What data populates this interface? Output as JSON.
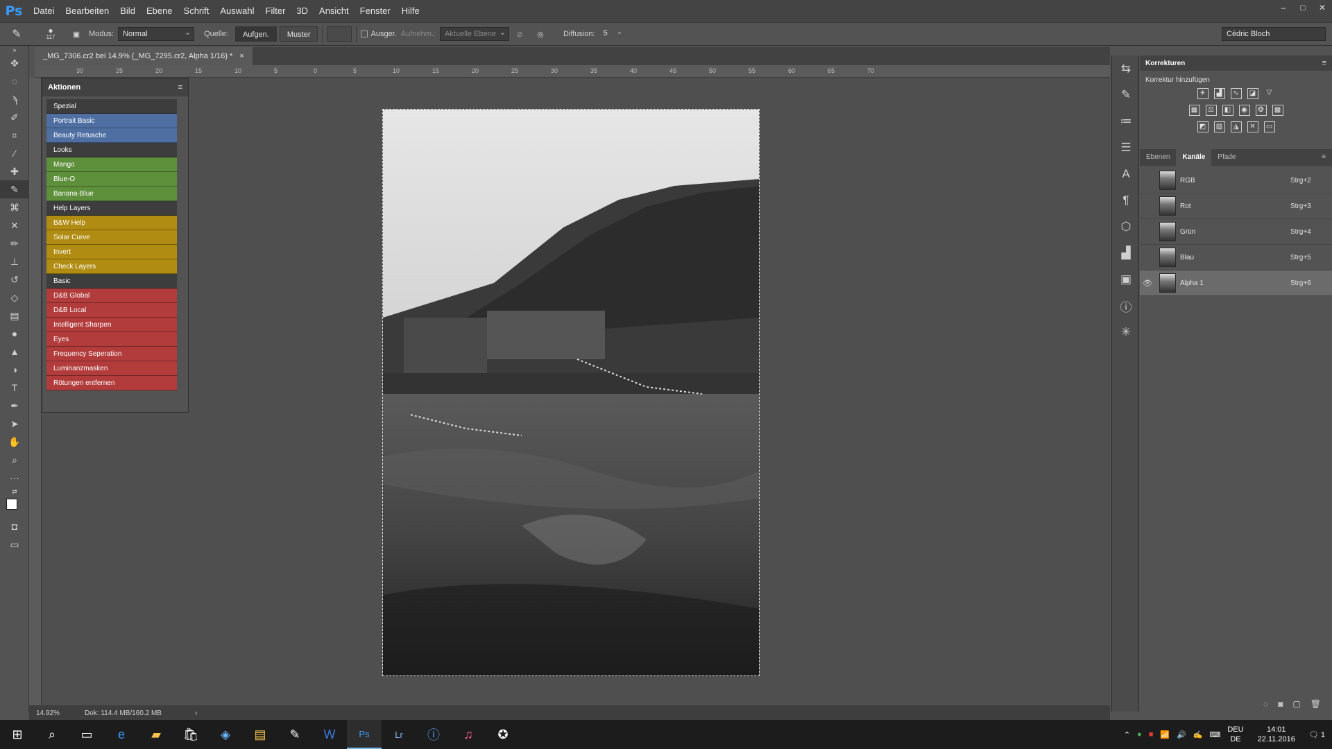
{
  "menubar": {
    "logo": "Ps",
    "items": [
      "Datei",
      "Bearbeiten",
      "Bild",
      "Ebene",
      "Schrift",
      "Auswahl",
      "Filter",
      "3D",
      "Ansicht",
      "Fenster",
      "Hilfe"
    ],
    "window_controls": [
      "–",
      "□",
      "✕"
    ]
  },
  "options": {
    "brush_size": "117",
    "mode_label": "Modus:",
    "mode_value": "Normal",
    "source_label": "Quelle:",
    "source_btn_sampled": "Aufgen.",
    "source_btn_pattern": "Muster",
    "aligned_label": "Ausger.",
    "sample_label": "Aufnehm.:",
    "sample_value": "Aktuelle Ebene",
    "diffusion_label": "Diffusion:",
    "diffusion_value": "5",
    "user": "Cédric Bloch"
  },
  "document": {
    "tab_title": "_MG_7306.cr2 bei 14.9% (_MG_7295.cr2, Alpha 1/16) *",
    "close": "×",
    "ruler_top": [
      "30",
      "25",
      "20",
      "15",
      "10",
      "5",
      "0",
      "5",
      "10",
      "15",
      "20",
      "25",
      "30",
      "35",
      "40",
      "45",
      "50",
      "55",
      "60",
      "65",
      "70"
    ],
    "zoom": "14.92%",
    "doc_info": "Dok: 114.4 MB/160.2 MB"
  },
  "actions_panel": {
    "title": "Aktionen",
    "items": [
      {
        "label": "Spezial",
        "color": "#3d3d3d"
      },
      {
        "label": "Portrait Basic",
        "color": "#4f6fa3"
      },
      {
        "label": "Beauty Retusche",
        "color": "#4f6fa3"
      },
      {
        "label": "Looks",
        "color": "#3d3d3d"
      },
      {
        "label": "Mango",
        "color": "#5e8f3a"
      },
      {
        "label": "Blue-O",
        "color": "#5e8f3a"
      },
      {
        "label": "Banana-Blue",
        "color": "#5e8f3a"
      },
      {
        "label": "Help Layers",
        "color": "#3d3d3d"
      },
      {
        "label": "B&W Help",
        "color": "#b08c12"
      },
      {
        "label": "Solar Curve",
        "color": "#b08c12"
      },
      {
        "label": "Invert",
        "color": "#b08c12"
      },
      {
        "label": "Check Layers",
        "color": "#b08c12"
      },
      {
        "label": "Basic",
        "color": "#3d3d3d"
      },
      {
        "label": "D&B Global",
        "color": "#b23b3b"
      },
      {
        "label": "D&B Local",
        "color": "#b23b3b"
      },
      {
        "label": "Intelligent Sharpen",
        "color": "#b23b3b"
      },
      {
        "label": "Eyes",
        "color": "#b23b3b"
      },
      {
        "label": "Frequency Seperation",
        "color": "#b23b3b"
      },
      {
        "label": "Luminanzmasken",
        "color": "#b23b3b"
      },
      {
        "label": "Rötungen entfernen",
        "color": "#b23b3b"
      }
    ]
  },
  "adjustments": {
    "title": "Korrekturen",
    "subtitle": "Korrektur hinzufügen"
  },
  "channels_panel": {
    "tabs": [
      "Ebenen",
      "Kanäle",
      "Pfade"
    ],
    "active_tab": "Kanäle",
    "channels": [
      {
        "name": "RGB",
        "shortcut": "Strg+2",
        "visible": false,
        "selected": false
      },
      {
        "name": "Rot",
        "shortcut": "Strg+3",
        "visible": false,
        "selected": false
      },
      {
        "name": "Grün",
        "shortcut": "Strg+4",
        "visible": false,
        "selected": false
      },
      {
        "name": "Blau",
        "shortcut": "Strg+5",
        "visible": false,
        "selected": false
      },
      {
        "name": "Alpha 1",
        "shortcut": "Strg+6",
        "visible": true,
        "selected": true
      }
    ]
  },
  "taskbar": {
    "lang": "DEU",
    "lang2": "DE",
    "time": "14:01",
    "date": "22.11.2016",
    "notifications": "1"
  }
}
